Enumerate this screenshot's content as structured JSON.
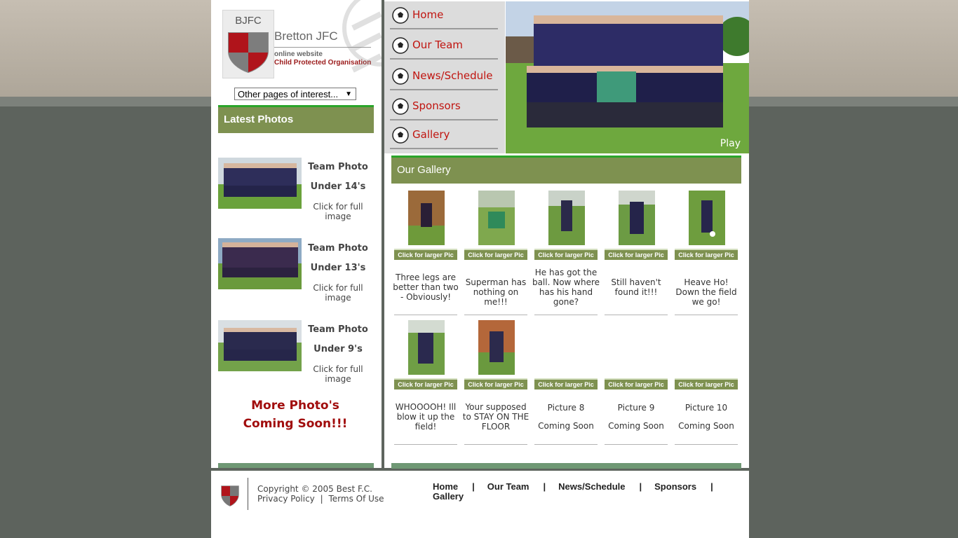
{
  "site": {
    "abbr": "BJFC",
    "name": "Bretton JFC",
    "tagline": "online website",
    "protected": "Child Protected Organisation"
  },
  "select": {
    "value": "Other pages of interest..."
  },
  "nav": {
    "items": [
      {
        "label": "Home"
      },
      {
        "label": "Our Team"
      },
      {
        "label": "News/Schedule"
      },
      {
        "label": "Sponsors"
      },
      {
        "label": "Gallery"
      }
    ]
  },
  "hero": {
    "play_label": "Play"
  },
  "latest": {
    "title": "Latest Photos",
    "items": [
      {
        "title": "Team Photo",
        "sub": "Under 14's",
        "link": "Click for full image"
      },
      {
        "title": "Team Photo",
        "sub": "Under 13's",
        "link": "Click for full image"
      },
      {
        "title": "Team Photo",
        "sub": "Under 9's",
        "link": "Click for full image"
      }
    ],
    "coming_1": "More Photo's",
    "coming_2": "Coming Soon!!!"
  },
  "gallery": {
    "title": "Our Gallery",
    "button_label": "Click for larger Pic",
    "row1": [
      {
        "caption": "Three legs are better than two - Obviously!"
      },
      {
        "caption": "Superman has nothing on me!!!"
      },
      {
        "caption": "He has got the ball. Now where has his hand gone?"
      },
      {
        "caption": "Still haven't found it!!!"
      },
      {
        "caption": "Heave Ho! Down the field we go!"
      }
    ],
    "row2": [
      {
        "caption": "WHOOOOH! Ill blow it up the field!"
      },
      {
        "caption": "Your supposed to STAY ON THE FLOOR"
      },
      {
        "title": "Picture 8",
        "sub": "Coming Soon"
      },
      {
        "title": "Picture 9",
        "sub": "Coming Soon"
      },
      {
        "title": "Picture 10",
        "sub": "Coming Soon"
      }
    ]
  },
  "footer": {
    "copyright": "Copyright © 2005 Best F.C.",
    "privacy": "Privacy Policy",
    "sep": "|",
    "terms": "Terms Of Use",
    "nav": [
      "Home",
      "Our Team",
      "News/Schedule",
      "Sponsors",
      "Gallery"
    ]
  }
}
